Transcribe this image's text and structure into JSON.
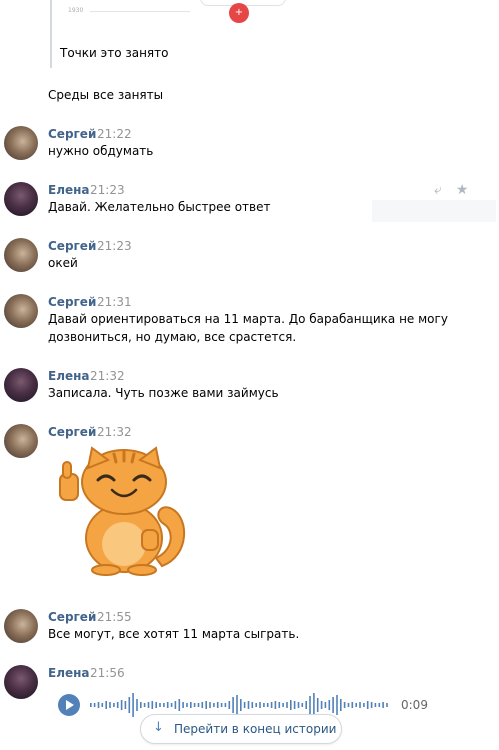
{
  "top": {
    "mini_preview_text": "1930",
    "plus_label": "+",
    "quoted_text": "Точки это занято",
    "plain_text": "Среды все заняты"
  },
  "messages": [
    {
      "author": "Сергей",
      "time": "21:22",
      "text": "нужно обдумать",
      "avatar": "sergey"
    },
    {
      "author": "Елена",
      "time": "21:23",
      "text": "Давай. Желательно быстрее ответ",
      "avatar": "elena"
    },
    {
      "author": "Сергей",
      "time": "21:23",
      "text": "окей",
      "avatar": "sergey"
    },
    {
      "author": "Сергей",
      "time": "21:31",
      "text": "Давай ориентироваться на 11 марта. До барабанщика не могу дозвониться, но думаю, все срастется.",
      "avatar": "sergey"
    },
    {
      "author": "Елена",
      "time": "21:32",
      "text": "Записала. Чуть позже вами займусь",
      "avatar": "elena"
    },
    {
      "author": "Сергей",
      "time": "21:32",
      "text": "",
      "avatar": "sergey",
      "attachment": "sticker"
    },
    {
      "author": "Сергей",
      "time": "21:55",
      "text": "Все могут, все хотят 11 марта сыграть.",
      "avatar": "sergey"
    },
    {
      "author": "Елена",
      "time": "21:56",
      "text": "",
      "avatar": "elena",
      "attachment": "voice"
    }
  ],
  "hover_actions": {
    "reply_icon": "reply-icon",
    "star_icon": "star-icon"
  },
  "voice": {
    "duration": "0:09"
  },
  "jump_button": {
    "label": "Перейти в конец истории",
    "icon": "arrow-down-icon"
  },
  "colors": {
    "name": "#42648b",
    "time": "#939393",
    "accent": "#5181b8",
    "red": "#e64646"
  }
}
